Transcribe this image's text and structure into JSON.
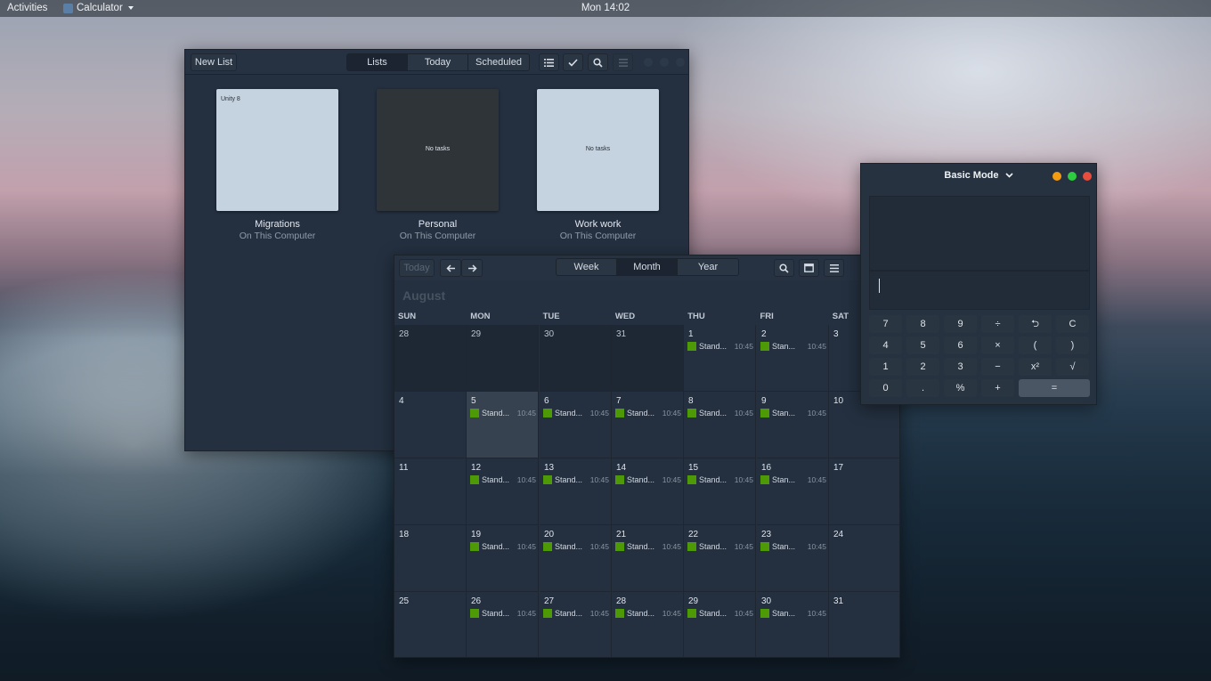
{
  "topbar": {
    "activities": "Activities",
    "app_name": "Calculator",
    "clock": "Mon 14:02"
  },
  "todo": {
    "new_list": "New List",
    "tabs": [
      "Lists",
      "Today",
      "Scheduled"
    ],
    "active_tab": "Lists",
    "cards": [
      {
        "title": "Migrations",
        "subtitle": "On This Computer",
        "content": "Unity 8",
        "color": "#c5d3e0"
      },
      {
        "title": "Personal",
        "subtitle": "On This Computer",
        "content": "No tasks",
        "color": "#2e3438"
      },
      {
        "title": "Work work",
        "subtitle": "On This Computer",
        "content": "No tasks",
        "color": "#c5d3e0"
      }
    ]
  },
  "calendar": {
    "today_button": "Today",
    "views": [
      "Week",
      "Month",
      "Year"
    ],
    "active_view": "Month",
    "month": "August",
    "weekdays": [
      "SUN",
      "MON",
      "TUE",
      "WED",
      "THU",
      "FRI",
      "SAT"
    ],
    "event_color": "#4e9a06",
    "weeks": [
      [
        {
          "d": "28",
          "o": true
        },
        {
          "d": "29",
          "o": true
        },
        {
          "d": "30",
          "o": true
        },
        {
          "d": "31",
          "o": true
        },
        {
          "d": "1",
          "e": "Stand...",
          "t": "10:45"
        },
        {
          "d": "2",
          "e": "Stan...",
          "t": "10:45"
        },
        {
          "d": "3"
        }
      ],
      [
        {
          "d": "4"
        },
        {
          "d": "5",
          "e": "Stand...",
          "t": "10:45",
          "today": true
        },
        {
          "d": "6",
          "e": "Stand...",
          "t": "10:45"
        },
        {
          "d": "7",
          "e": "Stand...",
          "t": "10:45"
        },
        {
          "d": "8",
          "e": "Stand...",
          "t": "10:45"
        },
        {
          "d": "9",
          "e": "Stan...",
          "t": "10:45"
        },
        {
          "d": "10"
        }
      ],
      [
        {
          "d": "11"
        },
        {
          "d": "12",
          "e": "Stand...",
          "t": "10:45"
        },
        {
          "d": "13",
          "e": "Stand...",
          "t": "10:45"
        },
        {
          "d": "14",
          "e": "Stand...",
          "t": "10:45"
        },
        {
          "d": "15",
          "e": "Stand...",
          "t": "10:45"
        },
        {
          "d": "16",
          "e": "Stan...",
          "t": "10:45"
        },
        {
          "d": "17"
        }
      ],
      [
        {
          "d": "18"
        },
        {
          "d": "19",
          "e": "Stand...",
          "t": "10:45"
        },
        {
          "d": "20",
          "e": "Stand...",
          "t": "10:45"
        },
        {
          "d": "21",
          "e": "Stand...",
          "t": "10:45"
        },
        {
          "d": "22",
          "e": "Stand...",
          "t": "10:45"
        },
        {
          "d": "23",
          "e": "Stan...",
          "t": "10:45"
        },
        {
          "d": "24"
        }
      ],
      [
        {
          "d": "25"
        },
        {
          "d": "26",
          "e": "Stand...",
          "t": "10:45"
        },
        {
          "d": "27",
          "e": "Stand...",
          "t": "10:45"
        },
        {
          "d": "28",
          "e": "Stand...",
          "t": "10:45"
        },
        {
          "d": "29",
          "e": "Stand...",
          "t": "10:45"
        },
        {
          "d": "30",
          "e": "Stan...",
          "t": "10:45"
        },
        {
          "d": "31"
        }
      ]
    ]
  },
  "calculator": {
    "mode": "Basic Mode",
    "keys": [
      [
        "7",
        "8",
        "9",
        "÷",
        "⮌",
        "C"
      ],
      [
        "4",
        "5",
        "6",
        "×",
        "(",
        ")"
      ],
      [
        "1",
        "2",
        "3",
        "−",
        "x²",
        "√"
      ],
      [
        "0",
        ".",
        "%",
        "+",
        "="
      ]
    ],
    "dot_colors": [
      "#f39c12",
      "#2ecc40",
      "#e74c3c"
    ]
  }
}
